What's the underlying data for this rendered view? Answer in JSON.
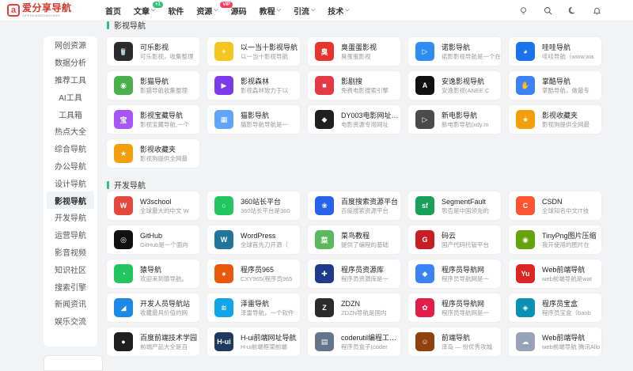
{
  "logo": {
    "badge": "a",
    "title": "爱分享导航",
    "subtitle": "AIFENXIANGDAOHANG"
  },
  "nav": [
    {
      "label": "首页",
      "chevron": false
    },
    {
      "label": "文章",
      "chevron": true,
      "badge": "+1"
    },
    {
      "label": "软件",
      "chevron": false
    },
    {
      "label": "资源",
      "chevron": true,
      "badge": "VIP"
    },
    {
      "label": "源码",
      "chevron": false
    },
    {
      "label": "教程",
      "chevron": true
    },
    {
      "label": "引流",
      "chevron": true
    },
    {
      "label": "技术",
      "chevron": true
    }
  ],
  "nav_chevron_glyph": "⌵",
  "sidebar": [
    {
      "label": "网创资源"
    },
    {
      "label": "数据分析"
    },
    {
      "label": "推荐工具"
    },
    {
      "label": "AI工具"
    },
    {
      "label": "工具箱"
    },
    {
      "label": "热点大全"
    },
    {
      "label": "综合导航"
    },
    {
      "label": "办公导航"
    },
    {
      "label": "设计导航"
    },
    {
      "label": "影视导航",
      "active": true
    },
    {
      "label": "开发导航"
    },
    {
      "label": "运营导航"
    },
    {
      "label": "影音视频"
    },
    {
      "label": "知识社区"
    },
    {
      "label": "搜索引擎"
    },
    {
      "label": "新闻资讯"
    },
    {
      "label": "娱乐交流"
    }
  ],
  "sections": [
    {
      "title": "影视导航",
      "cards": [
        {
          "title": "可乐影视",
          "desc": "可乐影视，收集整理",
          "icon": "cola-icon",
          "glyph": "🥤",
          "bg": "#2b2b2b"
        },
        {
          "title": "以一当十影视导航",
          "desc": "以一当十影视导航",
          "icon": "plus-icon",
          "glyph": "+",
          "bg": "#f7c520"
        },
        {
          "title": "臭蛋蛋影视",
          "desc": "臭蛋蛋影视",
          "icon": "cdd-icon",
          "glyph": "臭",
          "bg": "#e6352b"
        },
        {
          "title": "诺影导航",
          "desc": "诺影影视导航是一个在",
          "icon": "play-icon",
          "glyph": "▷",
          "bg": "#2f8cf0"
        },
        {
          "title": "哇哇导航",
          "desc": "哇哇导航（www.wa",
          "icon": "doraemon-icon",
          "glyph": "◕",
          "bg": "#1a73e8"
        },
        {
          "title": "影猫导航",
          "desc": "影猫导航收集整理",
          "icon": "panda-icon",
          "glyph": "◉",
          "bg": "#4ab04a"
        },
        {
          "title": "影视森林",
          "desc": "影视森林致力于以",
          "icon": "forest-icon",
          "glyph": "▶",
          "bg": "#7c3aed"
        },
        {
          "title": "影剧搜",
          "desc": "免费电影搜索引擎",
          "icon": "camera-icon",
          "glyph": "■",
          "bg": "#e63946"
        },
        {
          "title": "安逸影视导航",
          "desc": "安逸影视(ANEE.C",
          "icon": "anee-icon",
          "glyph": "A",
          "bg": "#111111"
        },
        {
          "title": "掌酷导航",
          "desc": "掌酷导航，做最专",
          "icon": "hand-icon",
          "glyph": "✋",
          "bg": "#3b82f6"
        },
        {
          "title": "影视宝藏导航",
          "desc": "影视宝藏导航,一个",
          "icon": "treasure-icon",
          "glyph": "宝",
          "bg": "#a855f7"
        },
        {
          "title": "猫影导航",
          "desc": "猫影导航导航是一",
          "icon": "bars-icon",
          "glyph": "▦",
          "bg": "#60a5fa"
        },
        {
          "title": "DY003电影网址导航",
          "desc": "电影资源专用网址",
          "icon": "dy-icon",
          "glyph": "◆",
          "bg": "#1f1f1f"
        },
        {
          "title": "新电影导航",
          "desc": "新电影导航(xdy.m",
          "icon": "film-icon",
          "glyph": "▷",
          "bg": "#4a4a4a"
        },
        {
          "title": "影视收藏夹",
          "desc": "影视狗提供全网最",
          "icon": "bookmark-icon",
          "glyph": "★",
          "bg": "#f59e0b"
        },
        {
          "title": "影视收藏夹",
          "desc": "影视狗提供全网最",
          "icon": "bookmark-icon",
          "glyph": "★",
          "bg": "#f59e0b"
        }
      ]
    },
    {
      "title": "开发导航",
      "cards": [
        {
          "title": "W3school",
          "desc": "全球最大的中文 W",
          "icon": "w3-icon",
          "glyph": "W",
          "bg": "#e2483d"
        },
        {
          "title": "360站长平台",
          "desc": "360站长平台是360",
          "icon": "360-icon",
          "glyph": "○",
          "bg": "#22c55e"
        },
        {
          "title": "百度搜索资源平台",
          "desc": "百度搜索资源平台",
          "icon": "baidu-icon",
          "glyph": "❀",
          "bg": "#2563eb"
        },
        {
          "title": "SegmentFault",
          "desc": "思否是中国领先的",
          "icon": "sf-icon",
          "glyph": "sf",
          "bg": "#18a058"
        },
        {
          "title": "CSDN",
          "desc": "全球知名中文IT技",
          "icon": "csdn-icon",
          "glyph": "C",
          "bg": "#fc5531"
        },
        {
          "title": "GitHub",
          "desc": "GitHub是一个面向",
          "icon": "github-icon",
          "glyph": "◎",
          "bg": "#111111"
        },
        {
          "title": "WordPress",
          "desc": "全球首先刀开源（",
          "icon": "wordpress-icon",
          "glyph": "W",
          "bg": "#21759b"
        },
        {
          "title": "菜鸟教程",
          "desc": "提供了编程的基础",
          "icon": "runoob-icon",
          "glyph": "菜",
          "bg": "#5cb85c"
        },
        {
          "title": "码云",
          "desc": "国产代码托管平台",
          "icon": "gitee-icon",
          "glyph": "G",
          "bg": "#c71d23"
        },
        {
          "title": "TinyPng图片压缩",
          "desc": "我开使用的图片在",
          "icon": "tinypng-icon",
          "glyph": "◉",
          "bg": "#65a30d"
        },
        {
          "title": "猿导航",
          "desc": "欢迎来到猿导航。",
          "icon": "chat-icon",
          "glyph": "◔",
          "bg": "#22c55e"
        },
        {
          "title": "程序员965",
          "desc": "CXY965(程序员965",
          "icon": "coin-icon",
          "glyph": "●",
          "bg": "#ea580c"
        },
        {
          "title": "程序员资源库",
          "desc": "程序员资源库是一",
          "icon": "puzzle-icon",
          "glyph": "✚",
          "bg": "#1e3a8a"
        },
        {
          "title": "程序员导航网",
          "desc": "程序员导航网是一",
          "icon": "tiles-icon",
          "glyph": "◆",
          "bg": "#3b82f6"
        },
        {
          "title": "Web前端导航",
          "desc": "web前端导航是wat",
          "icon": "yu-icon",
          "glyph": "Yu",
          "bg": "#dc2626"
        },
        {
          "title": "开发人员导航站",
          "desc": "收藏最具价值的网",
          "icon": "dev-icon",
          "glyph": "◢",
          "bg": "#1e88e5"
        },
        {
          "title": "泽雷导航",
          "desc": "泽雷导航，一个软件",
          "icon": "zelei-icon",
          "glyph": "≋",
          "bg": "#0ea5e9"
        },
        {
          "title": "ZDZN",
          "desc": "ZDZN导航是国内",
          "icon": "zdzn-icon",
          "glyph": "Z",
          "bg": "#2b2b2b"
        },
        {
          "title": "程序员导航网",
          "desc": "程序员导航网是一",
          "icon": "flower-icon",
          "glyph": "✿",
          "bg": "#e11d48"
        },
        {
          "title": "程序员宝盒",
          "desc": "程序员宝盒（baob",
          "icon": "box-icon",
          "glyph": "◈",
          "bg": "#0891b2"
        },
        {
          "title": "百度前端技术学园",
          "desc": "前端产品大全是百",
          "icon": "ife-icon",
          "glyph": "●",
          "bg": "#1f1f1f"
        },
        {
          "title": "H-ui前端网址导航",
          "desc": "H-ui前端框架前端",
          "icon": "hui-icon",
          "glyph": "H-ui",
          "bg": "#1e3a5f"
        },
        {
          "title": "coderutil编程工具导航",
          "desc": "程序员盒子(coder",
          "icon": "coderutil-icon",
          "glyph": "▤",
          "bg": "#64748b"
        },
        {
          "title": "前端导航",
          "desc": "泽岛 — 份优秀攻城",
          "icon": "avatar-icon",
          "glyph": "☺",
          "bg": "#92400e"
        },
        {
          "title": "Web前端导航",
          "desc": "web前端导航 腾讯Allo",
          "icon": "cloud-icon",
          "glyph": "☁",
          "bg": "#94a3b8"
        }
      ]
    }
  ]
}
